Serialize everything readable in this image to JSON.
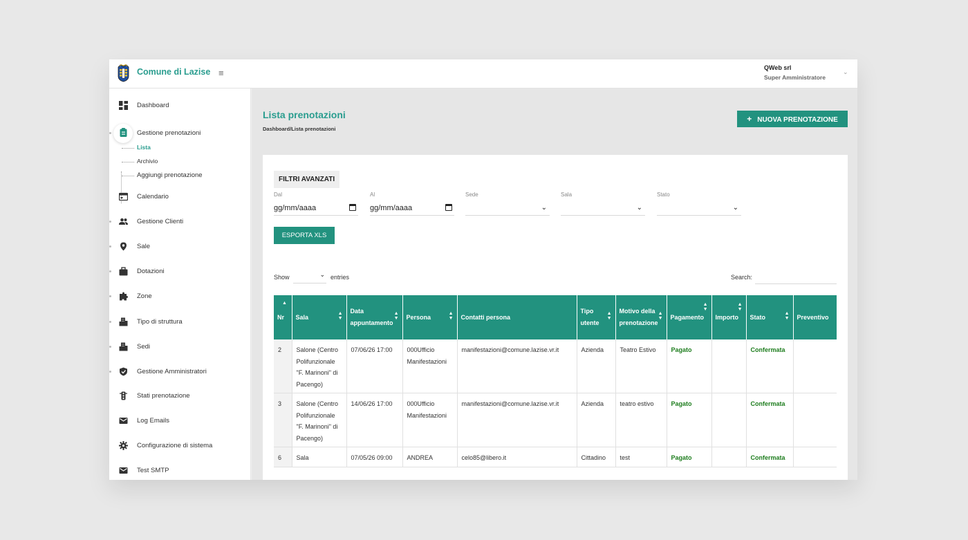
{
  "app": {
    "brand": "Comune di Lazise",
    "user_name": "QWeb srl",
    "user_role": "Super Amministratore"
  },
  "sidebar": {
    "items": [
      {
        "label": "Dashboard",
        "icon": "dashboard-icon"
      },
      {
        "label": "Gestione prenotazioni",
        "icon": "clipboard-icon"
      },
      {
        "label": "Calendario",
        "icon": "calendar-icon"
      },
      {
        "label": "Gestione Clienti",
        "icon": "users-icon"
      },
      {
        "label": "Sale",
        "icon": "map-pin-icon"
      },
      {
        "label": "Dotazioni",
        "icon": "briefcase-icon"
      },
      {
        "label": "Zone",
        "icon": "puzzle-icon"
      },
      {
        "label": "Tipo di struttura",
        "icon": "building-icon"
      },
      {
        "label": "Sedi",
        "icon": "building-icon"
      },
      {
        "label": "Gestione Amministratori",
        "icon": "shield-icon"
      },
      {
        "label": "Stati prenotazione",
        "icon": "traffic-light-icon"
      },
      {
        "label": "Log Emails",
        "icon": "mail-icon"
      },
      {
        "label": "Configurazione di sistema",
        "icon": "gear-icon"
      },
      {
        "label": "Test SMTP",
        "icon": "mail-icon"
      }
    ],
    "subitems": [
      "Lista",
      "Archivio",
      "Aggiungi prenotazione"
    ]
  },
  "page": {
    "title": "Lista prenotazioni",
    "breadcrumb_home": "Dashboard",
    "breadcrumb_sep": "/",
    "breadcrumb_current": "Lista prenotazioni",
    "new_button": "NUOVA PRENOTAZIONE"
  },
  "filters": {
    "heading": "FILTRI AVANZATI",
    "dal_label": "Dal",
    "dal_value": "gg/mm/aaaa",
    "al_label": "Al",
    "al_value": "gg/mm/aaaa",
    "sede_label": "Sede",
    "sala_label": "Sala",
    "stato_label": "Stato",
    "export_button": "ESPORTA XLS"
  },
  "table_controls": {
    "show_label": "Show",
    "entries_label": "entries",
    "search_label": "Search:"
  },
  "table": {
    "headers": [
      "Nr",
      "Sala",
      "Data appuntamento",
      "Persona",
      "Contatti persona",
      "Tipo utente",
      "Motivo della prenotazione",
      "Pagamento",
      "Importo",
      "Stato",
      "Preventivo"
    ],
    "rows": [
      {
        "nr": "2",
        "sala": "Salone (Centro Polifunzionale \"F. Marinoni\" di Pacengo)",
        "data": "07/06/26 17:00",
        "persona": "000Ufficio Manifestazioni",
        "contatti": "manifestazioni@comune.lazise.vr.it",
        "tipo": "Azienda",
        "motivo": "Teatro Estivo",
        "pagamento": "Pagato",
        "importo": "",
        "stato": "Confermata",
        "preventivo": ""
      },
      {
        "nr": "3",
        "sala": "Salone (Centro Polifunzionale \"F. Marinoni\" di Pacengo)",
        "data": "14/06/26 17:00",
        "persona": "000Ufficio Manifestazioni",
        "contatti": "manifestazioni@comune.lazise.vr.it",
        "tipo": "Azienda",
        "motivo": "teatro estivo",
        "pagamento": "Pagato",
        "importo": "",
        "stato": "Confermata",
        "preventivo": ""
      },
      {
        "nr": "6",
        "sala": "Sala",
        "data": "07/05/26 09:00",
        "persona": "ANDREA",
        "contatti": "celo85@libero.it",
        "tipo": "Cittadino",
        "motivo": "test",
        "pagamento": "Pagato",
        "importo": "",
        "stato": "Confermata",
        "preventivo": ""
      }
    ]
  },
  "colors": {
    "accent": "#22927f",
    "brand_text": "#2a9d8f",
    "paid_text": "#1e7d1e"
  }
}
